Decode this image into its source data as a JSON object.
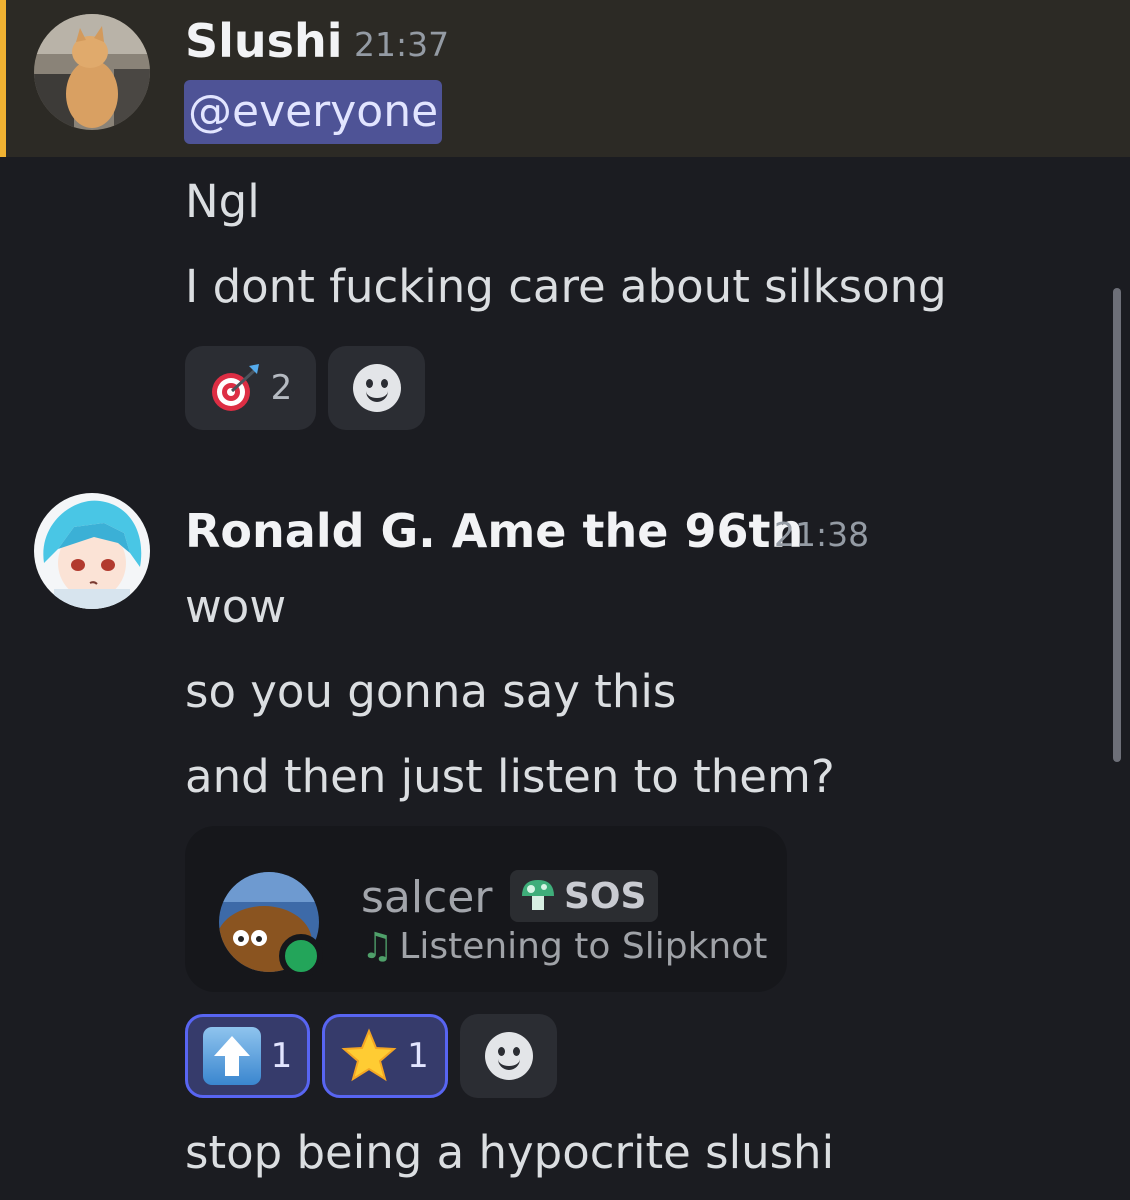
{
  "messages": [
    {
      "username": "Slushi",
      "timestamp": "21:37",
      "mention": "@everyone",
      "lines": [
        "Ngl",
        "I dont fucking care about silksong"
      ],
      "reactions": [
        {
          "emoji": "direct-hit-emoji",
          "count": "2"
        }
      ]
    },
    {
      "username": "Ronald G. Ame the 96th",
      "timestamp": "21:38",
      "lines": [
        "wow",
        "so you gonna say this",
        "and then just listen to them?"
      ],
      "embed": {
        "name": "salcer",
        "tag": "SOS",
        "activity": "Listening to Slipknot"
      },
      "reactions": [
        {
          "emoji": "up-arrow-emoji",
          "count": "1"
        },
        {
          "emoji": "star-emoji",
          "count": "1"
        }
      ],
      "last_line": "stop being a hypocrite slushi"
    }
  ],
  "colors": {
    "background": "#1b1c21",
    "highlight": "#2c2a25",
    "highlight_bar": "#f0b232",
    "mention_bg": "#4e5396",
    "reaction_active_border": "#5865f2",
    "online": "#23a55a"
  }
}
